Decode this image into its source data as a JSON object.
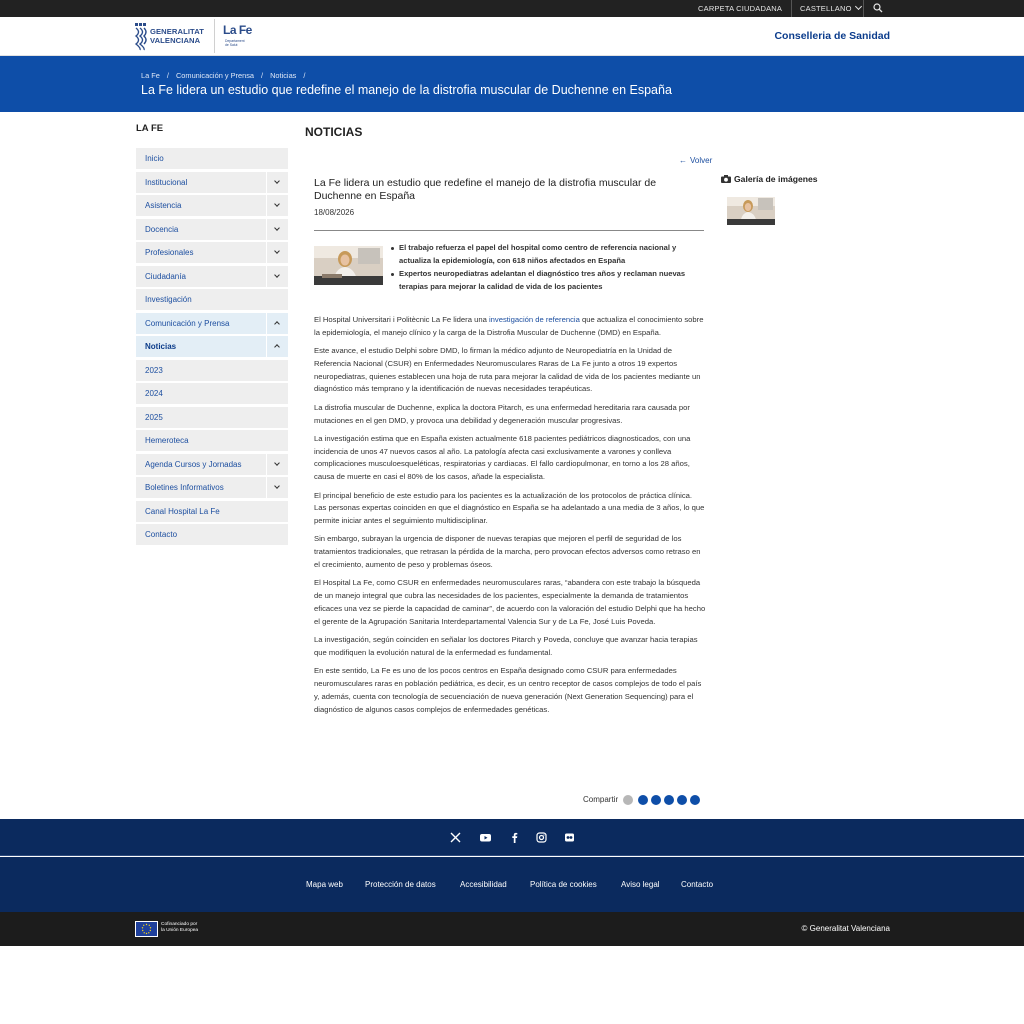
{
  "topbar": {
    "carpeta": "CARPETA CIUDADANA",
    "language": "CASTELLANO",
    "search_icon": "search-icon"
  },
  "header": {
    "gva_line1": "GENERALITAT",
    "gva_line2": "VALENCIANA",
    "lafe_logo": "La Fe",
    "lafe_sub": "Departament de Salut",
    "conselleria": "Conselleria de Sanidad"
  },
  "banner": {
    "breadcrumbs": [
      "La Fe",
      "Comunicación y Prensa",
      "Noticias"
    ],
    "title": "La Fe lidera un estudio que redefine el manejo de la distrofia muscular de Duchenne en España"
  },
  "sidebar": {
    "title": "LA FE",
    "items": [
      {
        "label": "Inicio",
        "toggle": "none"
      },
      {
        "label": "Institucional",
        "toggle": "down"
      },
      {
        "label": "Asistencia",
        "toggle": "down"
      },
      {
        "label": "Docencia",
        "toggle": "down"
      },
      {
        "label": "Profesionales",
        "toggle": "down"
      },
      {
        "label": "Ciudadanía",
        "toggle": "down"
      },
      {
        "label": "Investigación",
        "toggle": "none"
      },
      {
        "label": "Comunicación y Prensa",
        "toggle": "up"
      },
      {
        "label": "Noticias",
        "toggle": "up"
      },
      {
        "label": "2023",
        "toggle": "none"
      },
      {
        "label": "2024",
        "toggle": "none"
      },
      {
        "label": "2025",
        "toggle": "none"
      },
      {
        "label": "Hemeroteca",
        "toggle": "none"
      },
      {
        "label": "Agenda Cursos y Jornadas",
        "toggle": "down"
      },
      {
        "label": "Boletines Informativos",
        "toggle": "down"
      },
      {
        "label": "Canal Hospital La Fe",
        "toggle": "none"
      },
      {
        "label": "Contacto",
        "toggle": "none"
      }
    ]
  },
  "main": {
    "section_title": "NOTICIAS",
    "volver": "Volver",
    "article_title": "La Fe lidera un estudio que redefine el manejo de la distrofia muscular de Duchenne en España",
    "date": "18/08/2026",
    "bullets": [
      "El trabajo refuerza el papel del hospital como centro de referencia nacional y actualiza la epidemiología, con 618 niños afectados en España",
      "Expertos neuropediatras adelantan el diagnóstico tres años y reclaman nuevas terapias para mejorar la calidad de vida de los pacientes"
    ],
    "p1_before": "El Hospital Universitari i Politècnic La Fe lidera una ",
    "p1_link": "investigación de referencia",
    "p1_after": " que actualiza el conocimiento sobre la epidemiología, el manejo clínico y la carga de la Distrofia Muscular de Duchenne (DMD) en España.",
    "paragraphs": [
      "Este avance, el estudio Delphi sobre DMD, lo firman la médico adjunto de Neuropediatría en la Unidad de Referencia Nacional (CSUR) en Enfermedades Neuromusculares Raras de La Fe junto a otros 19 expertos neuropediatras, quienes establecen una hoja de ruta para mejorar la calidad de vida de los pacientes mediante un diagnóstico más temprano y la identificación de nuevas necesidades terapéuticas.",
      "La distrofia muscular de Duchenne, explica la doctora Pitarch, es una enfermedad hereditaria rara causada por mutaciones en el gen DMD, y provoca una debilidad y degeneración muscular progresivas.",
      "La investigación estima que en España existen actualmente 618 pacientes pediátricos diagnosticados, con una incidencia de unos 47 nuevos casos al año. La patología afecta casi exclusivamente a varones y conlleva complicaciones musculoesqueléticas, respiratorias y cardiacas. El fallo cardiopulmonar, en torno a los 28 años, causa de muerte en casi el 80% de los casos, añade la especialista.",
      "El principal beneficio de este estudio para los pacientes es la actualización de los protocolos de práctica clínica. Las personas expertas coinciden en que el diagnóstico en España se ha adelantado a una media de 3 años, lo que permite iniciar antes el seguimiento multidisciplinar.",
      "Sin embargo, subrayan la urgencia de disponer de nuevas terapias que mejoren el perfil de seguridad de los tratamientos tradicionales, que retrasan la pérdida de la marcha, pero provocan efectos adversos como retraso en el crecimiento, aumento de peso y problemas óseos.",
      "El Hospital La Fe, como CSUR en enfermedades neuromusculares raras, “abandera con este trabajo la búsqueda de un manejo integral que cubra las necesidades de los pacientes, especialmente la demanda de tratamientos eficaces una vez se pierde la capacidad de caminar”, de acuerdo con la valoración del estudio Delphi que ha hecho el gerente de la Agrupación Sanitaria Interdepartamental Valencia Sur y de La Fe, José Luis Poveda.",
      "La investigación, según coinciden en señalar los doctores Pitarch y Poveda, concluye que avanzar hacia terapias que modifiquen la evolución natural de la enfermedad es fundamental.",
      "En este sentido, La Fe es uno de los pocos centros en España designado como CSUR para enfermedades neuromusculares raras en población pediátrica, es decir, es un centro receptor de casos complejos de todo el país y, además, cuenta con tecnología de secuenciación de nueva generación (Next Generation Sequencing) para el diagnóstico de algunos casos complejos de enfermedades genéticas."
    ],
    "share_label": "Compartir",
    "share_icons": [
      "share-icon",
      "x-icon",
      "linkedin-icon",
      "facebook-icon",
      "email-icon",
      "whatsapp-icon"
    ]
  },
  "gallery": {
    "title": "Galería de imágenes"
  },
  "footer": {
    "social_icons": [
      "x-icon",
      "youtube-icon",
      "facebook-icon",
      "instagram-icon",
      "flickr-icon"
    ],
    "links": [
      "Mapa web",
      "Protección de datos",
      "Accesibilidad",
      "Política de cookies",
      "Aviso legal",
      "Contacto"
    ],
    "eu_line1": "Cofinanciado por",
    "eu_line2": "la Unión Europea",
    "copyright": "© Generalitat Valenciana"
  },
  "colors": {
    "brand_blue": "#0e4ea8",
    "footer_navy": "#0b2a5e",
    "topbar": "#222222",
    "link": "#1d4fa0"
  }
}
